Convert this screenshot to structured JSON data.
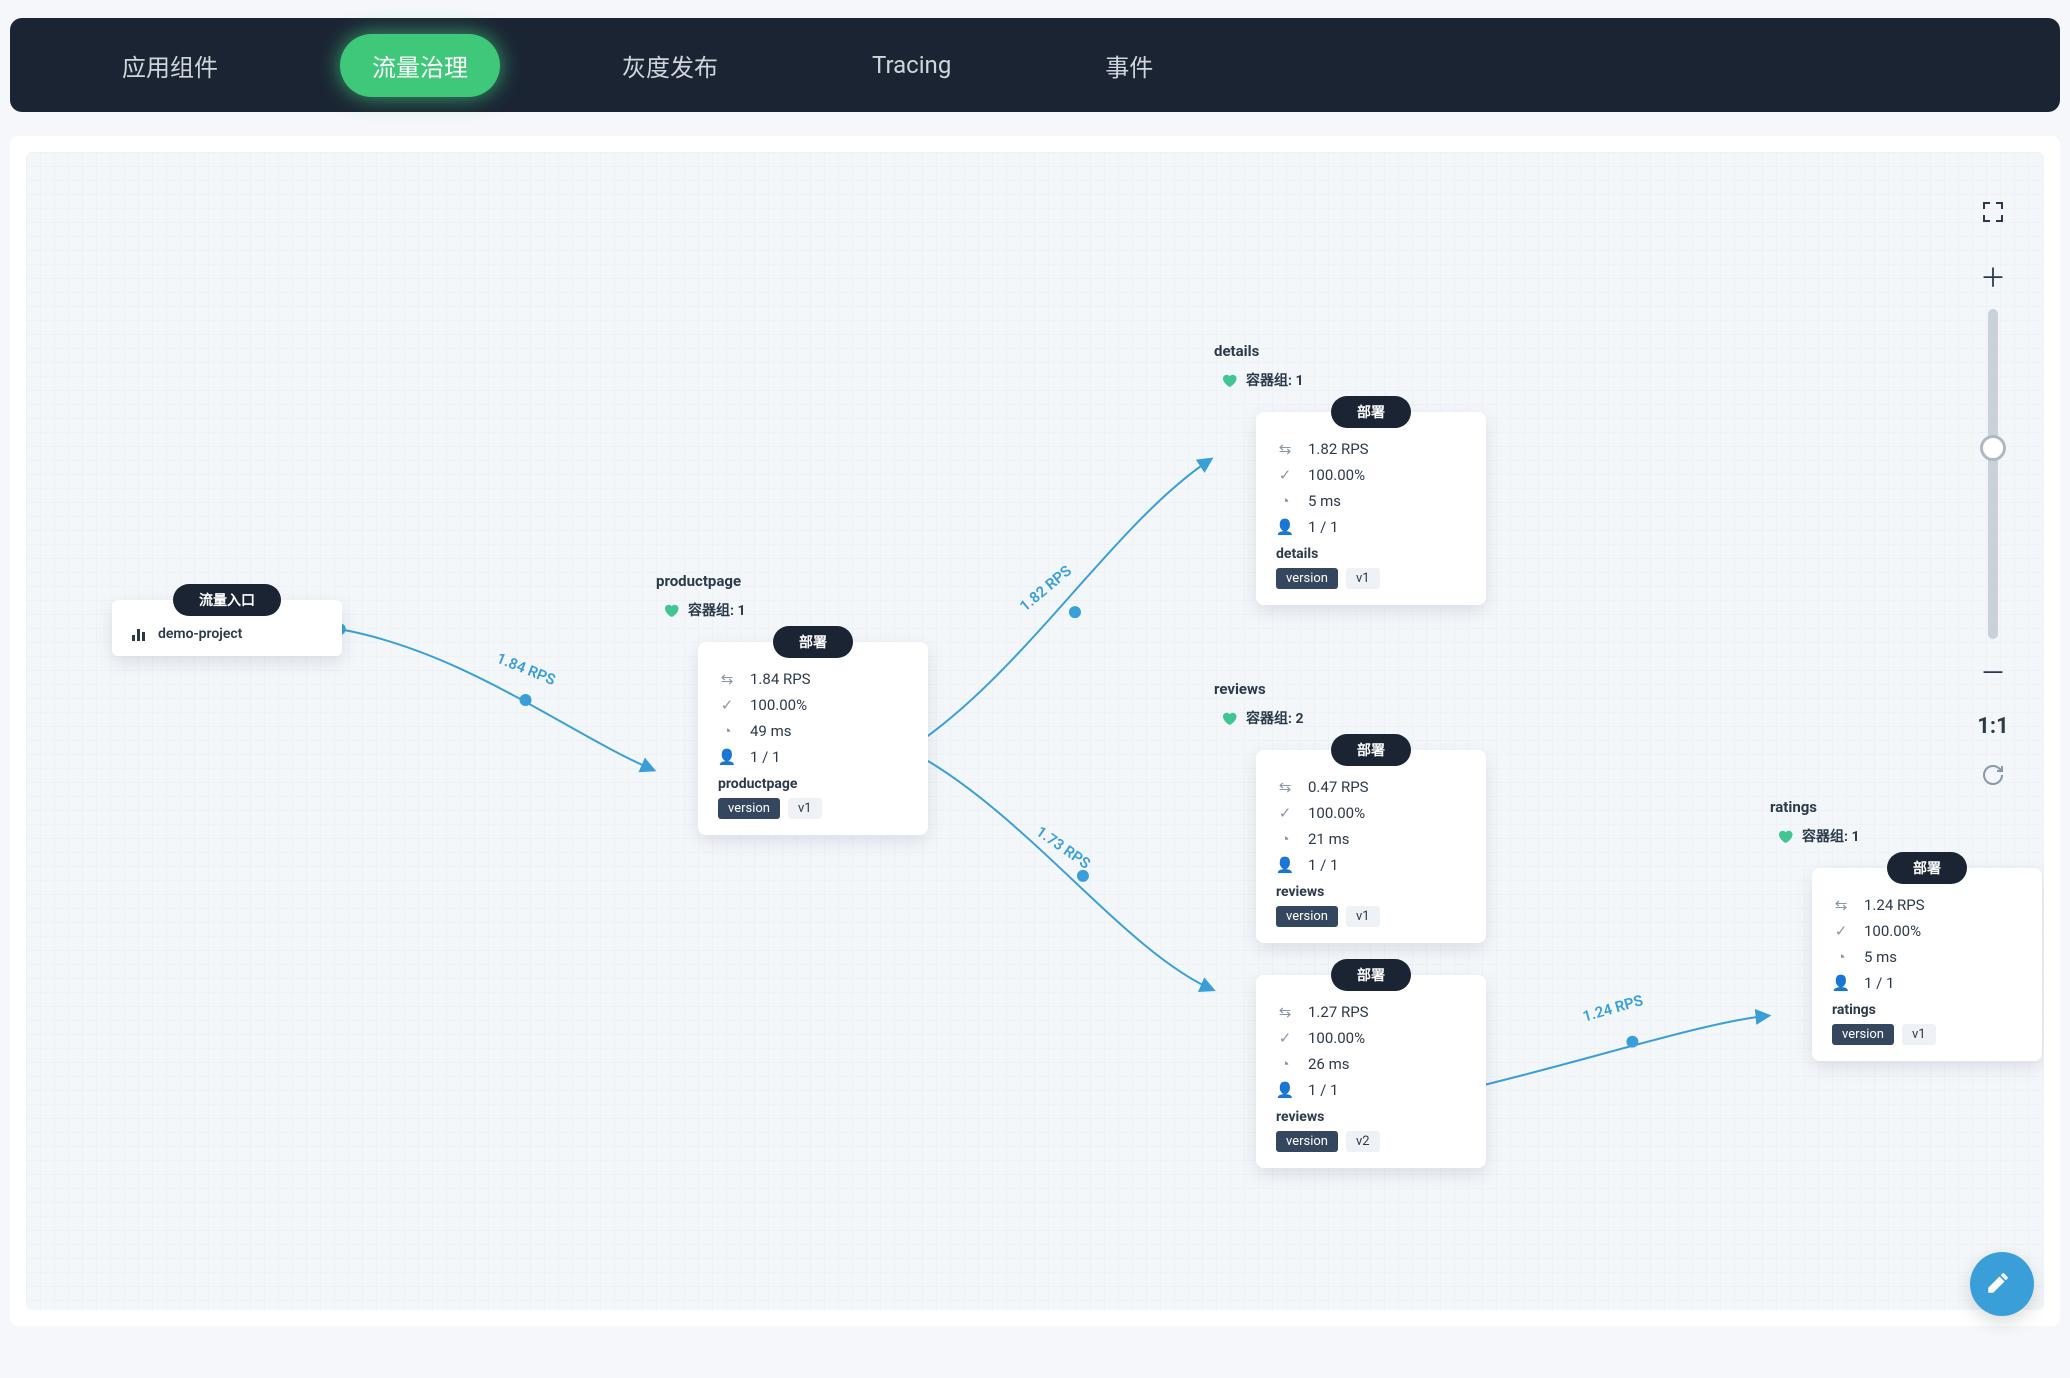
{
  "tabs": [
    "应用组件",
    "流量治理",
    "灰度发布",
    "Tracing",
    "事件"
  ],
  "active_tab_index": 1,
  "entry": {
    "pill": "流量入口",
    "project": "demo-project"
  },
  "labels": {
    "pods_prefix": "容器组: ",
    "deploy": "部署",
    "version": "version"
  },
  "controls": {
    "ratio": "1:1"
  },
  "edges": {
    "e1": "1.84 RPS",
    "e2": "1.82 RPS",
    "e3": "1.73 RPS",
    "e4": "1.24 RPS"
  },
  "services": {
    "productpage": {
      "title": "productpage",
      "pods": "1",
      "deploys": [
        {
          "rps": "1.84 RPS",
          "success": "100.00%",
          "latency": "49 ms",
          "replicas": "1 / 1",
          "name": "productpage",
          "version": "v1"
        }
      ]
    },
    "details": {
      "title": "details",
      "pods": "1",
      "deploys": [
        {
          "rps": "1.82 RPS",
          "success": "100.00%",
          "latency": "5 ms",
          "replicas": "1 / 1",
          "name": "details",
          "version": "v1"
        }
      ]
    },
    "reviews": {
      "title": "reviews",
      "pods": "2",
      "deploys": [
        {
          "rps": "0.47 RPS",
          "success": "100.00%",
          "latency": "21 ms",
          "replicas": "1 / 1",
          "name": "reviews",
          "version": "v1"
        },
        {
          "rps": "1.27 RPS",
          "success": "100.00%",
          "latency": "26 ms",
          "replicas": "1 / 1",
          "name": "reviews",
          "version": "v2"
        }
      ]
    },
    "ratings": {
      "title": "ratings",
      "pods": "1",
      "deploys": [
        {
          "rps": "1.24 RPS",
          "success": "100.00%",
          "latency": "5 ms",
          "replicas": "1 / 1",
          "name": "ratings",
          "version": "v1"
        }
      ]
    }
  }
}
